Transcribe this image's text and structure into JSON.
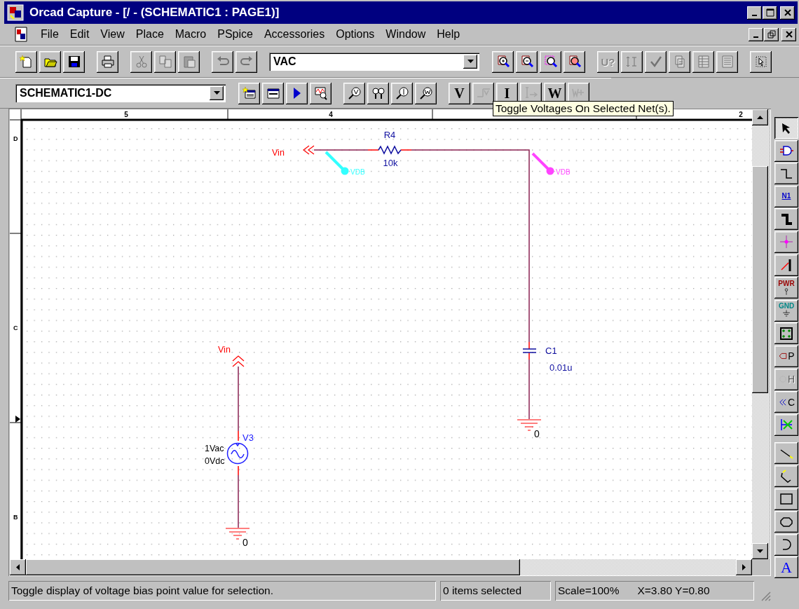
{
  "window": {
    "title": "Orcad Capture - [/ - (SCHEMATIC1 : PAGE1)]"
  },
  "menu": [
    "File",
    "Edit",
    "View",
    "Place",
    "Macro",
    "PSpice",
    "Accessories",
    "Options",
    "Window",
    "Help"
  ],
  "toolbar_1": [
    {
      "kind": "new",
      "disabled": false
    },
    {
      "kind": "open",
      "disabled": false
    },
    {
      "kind": "save",
      "disabled": false
    },
    {
      "kind": "separator"
    },
    {
      "kind": "print",
      "disabled": false
    },
    {
      "kind": "separator"
    },
    {
      "kind": "cut",
      "disabled": true
    },
    {
      "kind": "copy",
      "disabled": true
    },
    {
      "kind": "paste",
      "disabled": true
    },
    {
      "kind": "separator"
    },
    {
      "kind": "undo",
      "disabled": true
    },
    {
      "kind": "redo",
      "disabled": true
    },
    {
      "kind": "separator"
    },
    {
      "kind": "combo",
      "value": "VAC"
    },
    {
      "kind": "separator"
    },
    {
      "kind": "zoom-in",
      "disabled": false
    },
    {
      "kind": "zoom-out",
      "disabled": false
    },
    {
      "kind": "zoom-area",
      "disabled": false
    },
    {
      "kind": "zoom-all",
      "disabled": false
    },
    {
      "kind": "separator"
    },
    {
      "kind": "text",
      "label": "U?",
      "disabled": true
    },
    {
      "kind": "annotate",
      "disabled": true
    },
    {
      "kind": "drc",
      "disabled": true
    },
    {
      "kind": "netlist",
      "disabled": true
    },
    {
      "kind": "bom",
      "disabled": true
    },
    {
      "kind": "table",
      "disabled": true
    },
    {
      "kind": "separator"
    },
    {
      "kind": "pointer",
      "disabled": false
    }
  ],
  "toolbar_2": [
    {
      "kind": "combo",
      "value": "SCHEMATIC1-DC"
    },
    {
      "kind": "separator"
    },
    {
      "kind": "sim-profile",
      "disabled": false
    },
    {
      "kind": "edit-profile",
      "disabled": false
    },
    {
      "kind": "run",
      "disabled": false
    },
    {
      "kind": "probe",
      "disabled": false
    },
    {
      "kind": "separator"
    },
    {
      "kind": "voltage-marker",
      "disabled": false
    },
    {
      "kind": "diff-marker",
      "disabled": false
    },
    {
      "kind": "current-marker",
      "disabled": false
    },
    {
      "kind": "power-marker",
      "disabled": false
    },
    {
      "kind": "separator"
    },
    {
      "kind": "text",
      "label": "V",
      "disabled": false
    },
    {
      "kind": "net-voltage",
      "disabled": true
    },
    {
      "kind": "text",
      "label": "I",
      "disabled": false
    },
    {
      "kind": "pin-current",
      "disabled": true
    },
    {
      "kind": "text",
      "label": "W",
      "disabled": false
    },
    {
      "kind": "pin-power",
      "disabled": true
    }
  ],
  "tooltip": "Toggle Voltages On Selected Net(s).",
  "ruler": {
    "columns": [
      "5",
      "4",
      "2"
    ],
    "rows": [
      "D",
      "C",
      "B"
    ]
  },
  "schematic": {
    "net_labels": [
      {
        "text": "Vin"
      },
      {
        "text": "Vin"
      }
    ],
    "resistor": {
      "ref": "R4",
      "value": "10k"
    },
    "capacitor": {
      "ref": "C1",
      "value": "0.01u"
    },
    "source": {
      "ref": "V3",
      "ac": "1Vac",
      "dc": "0Vdc"
    },
    "grounds": [
      {
        "text": "0"
      },
      {
        "text": "0"
      }
    ],
    "markers": [
      {
        "text": "VDB",
        "color": "#33ffff"
      },
      {
        "text": "VDB",
        "color": "#ff44ff"
      }
    ]
  },
  "palette": [
    {
      "kind": "select",
      "selected": true,
      "disabled": false
    },
    {
      "kind": "part",
      "selected": false,
      "disabled": false
    },
    {
      "kind": "wire",
      "selected": false,
      "disabled": false
    },
    {
      "kind": "net-alias",
      "label": "N1",
      "selected": false,
      "disabled": false
    },
    {
      "kind": "bus",
      "selected": false,
      "disabled": false
    },
    {
      "kind": "junction",
      "selected": false,
      "disabled": false
    },
    {
      "kind": "bus-entry",
      "selected": false,
      "disabled": false
    },
    {
      "kind": "power",
      "label": "PWR",
      "selected": false,
      "disabled": false
    },
    {
      "kind": "ground",
      "label": "GND",
      "selected": false,
      "disabled": false
    },
    {
      "kind": "block",
      "selected": false,
      "disabled": false
    },
    {
      "kind": "port",
      "label": "P",
      "selected": false,
      "disabled": false
    },
    {
      "kind": "pin",
      "label": "H",
      "selected": false,
      "disabled": true
    },
    {
      "kind": "off-page",
      "label": "C",
      "selected": false,
      "disabled": false
    },
    {
      "kind": "no-connect",
      "selected": false,
      "disabled": false
    },
    {
      "kind": "separator"
    },
    {
      "kind": "line",
      "selected": false,
      "disabled": false
    },
    {
      "kind": "polyline",
      "selected": false,
      "disabled": false
    },
    {
      "kind": "rectangle",
      "selected": false,
      "disabled": false
    },
    {
      "kind": "ellipse",
      "selected": false,
      "disabled": false
    },
    {
      "kind": "arc",
      "selected": false,
      "disabled": false
    },
    {
      "kind": "text",
      "label": "A",
      "selected": false,
      "disabled": false
    }
  ],
  "status_bar": {
    "message": "Toggle display of voltage bias point value for selection.",
    "selection": "0 items selected",
    "scale": "Scale=100%",
    "coordinates": "X=3.80 Y=0.80"
  }
}
